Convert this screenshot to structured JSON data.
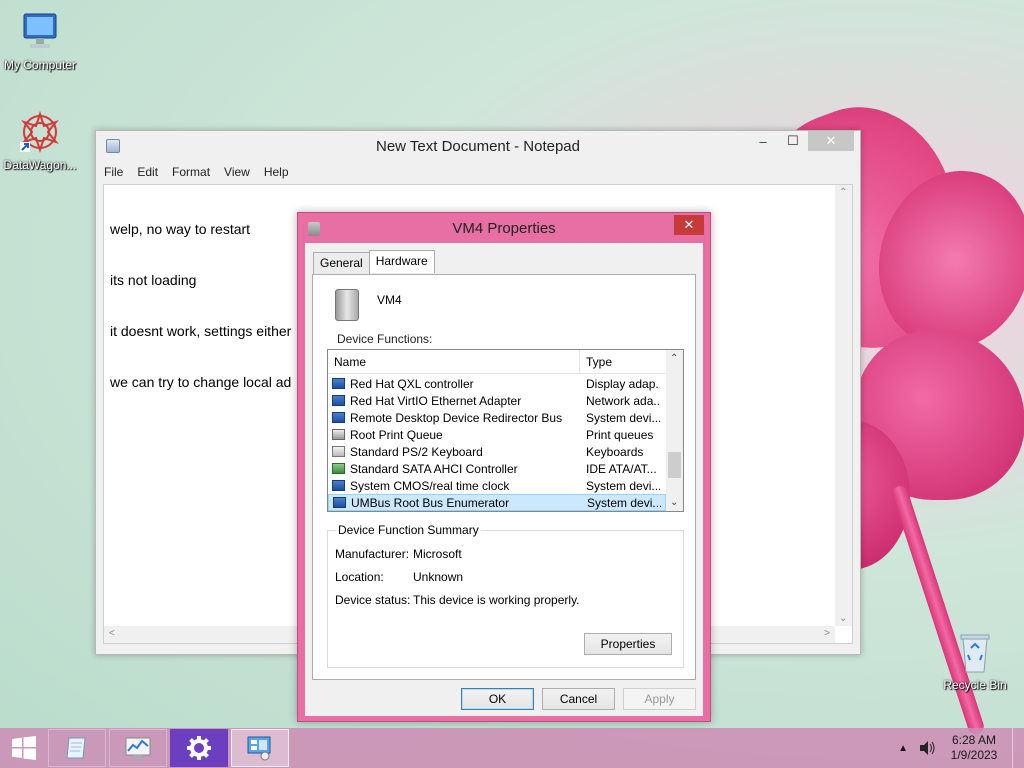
{
  "desktop": {
    "icons": [
      {
        "label": "My Computer"
      },
      {
        "label": "DataWagon..."
      },
      {
        "label": "Recycle Bin"
      }
    ]
  },
  "notepad": {
    "title": "New Text Document - Notepad",
    "menu": [
      "File",
      "Edit",
      "Format",
      "View",
      "Help"
    ],
    "lines": [
      "welp, no way to restart",
      "its not loading",
      "it doesnt work, settings either",
      "we can try to change local ad"
    ]
  },
  "dialog": {
    "title": "VM4 Properties",
    "tabs": [
      "General",
      "Hardware"
    ],
    "active_tab": "Hardware",
    "device_name": "VM4",
    "device_functions_label": "Device Functions:",
    "columns": [
      "Name",
      "Type"
    ],
    "rows": [
      {
        "name": "Red Hat QXL controller",
        "type": "Display adap..."
      },
      {
        "name": "Red Hat VirtIO Ethernet Adapter",
        "type": "Network ada..."
      },
      {
        "name": "Remote Desktop Device Redirector Bus",
        "type": "System devi..."
      },
      {
        "name": "Root Print Queue",
        "type": "Print queues"
      },
      {
        "name": "Standard PS/2 Keyboard",
        "type": "Keyboards"
      },
      {
        "name": "Standard SATA AHCI Controller",
        "type": "IDE ATA/AT..."
      },
      {
        "name": "System CMOS/real time clock",
        "type": "System devi..."
      },
      {
        "name": "UMBus Root Bus Enumerator",
        "type": "System devi..."
      }
    ],
    "selected_row": 7,
    "summary": {
      "legend": "Device Function Summary",
      "manufacturer_label": "Manufacturer:",
      "manufacturer": "Microsoft",
      "location_label": "Location:",
      "location": "Unknown",
      "status_label": "Device status:",
      "status": "This device is working properly."
    },
    "properties_button": "Properties",
    "ok_button": "OK",
    "cancel_button": "Cancel",
    "apply_button": "Apply"
  },
  "taskbar": {
    "time": "6:28 AM",
    "date": "1/9/2023"
  },
  "colors": {
    "dialog_frame": "#e76fa3",
    "taskbar": "#cd8cb4",
    "selection": "#cce8ff"
  }
}
